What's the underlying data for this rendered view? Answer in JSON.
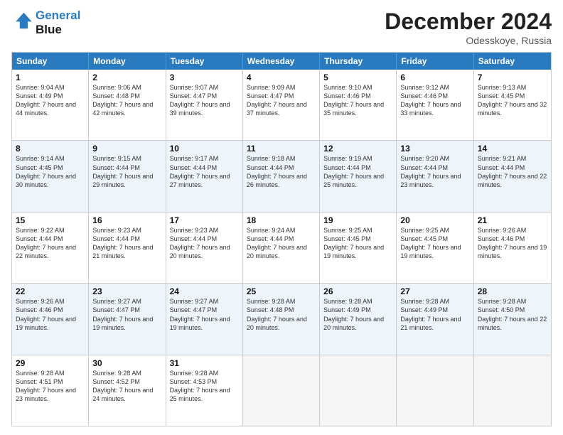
{
  "header": {
    "logo_line1": "General",
    "logo_line2": "Blue",
    "month": "December 2024",
    "location": "Odesskoye, Russia"
  },
  "days_of_week": [
    "Sunday",
    "Monday",
    "Tuesday",
    "Wednesday",
    "Thursday",
    "Friday",
    "Saturday"
  ],
  "rows": [
    [
      {
        "day": "1",
        "sunrise": "9:04 AM",
        "sunset": "4:49 PM",
        "daylight": "7 hours and 44 minutes."
      },
      {
        "day": "2",
        "sunrise": "9:06 AM",
        "sunset": "4:48 PM",
        "daylight": "7 hours and 42 minutes."
      },
      {
        "day": "3",
        "sunrise": "9:07 AM",
        "sunset": "4:47 PM",
        "daylight": "7 hours and 39 minutes."
      },
      {
        "day": "4",
        "sunrise": "9:09 AM",
        "sunset": "4:47 PM",
        "daylight": "7 hours and 37 minutes."
      },
      {
        "day": "5",
        "sunrise": "9:10 AM",
        "sunset": "4:46 PM",
        "daylight": "7 hours and 35 minutes."
      },
      {
        "day": "6",
        "sunrise": "9:12 AM",
        "sunset": "4:46 PM",
        "daylight": "7 hours and 33 minutes."
      },
      {
        "day": "7",
        "sunrise": "9:13 AM",
        "sunset": "4:45 PM",
        "daylight": "7 hours and 32 minutes."
      }
    ],
    [
      {
        "day": "8",
        "sunrise": "9:14 AM",
        "sunset": "4:45 PM",
        "daylight": "7 hours and 30 minutes."
      },
      {
        "day": "9",
        "sunrise": "9:15 AM",
        "sunset": "4:44 PM",
        "daylight": "7 hours and 29 minutes."
      },
      {
        "day": "10",
        "sunrise": "9:17 AM",
        "sunset": "4:44 PM",
        "daylight": "7 hours and 27 minutes."
      },
      {
        "day": "11",
        "sunrise": "9:18 AM",
        "sunset": "4:44 PM",
        "daylight": "7 hours and 26 minutes."
      },
      {
        "day": "12",
        "sunrise": "9:19 AM",
        "sunset": "4:44 PM",
        "daylight": "7 hours and 25 minutes."
      },
      {
        "day": "13",
        "sunrise": "9:20 AM",
        "sunset": "4:44 PM",
        "daylight": "7 hours and 23 minutes."
      },
      {
        "day": "14",
        "sunrise": "9:21 AM",
        "sunset": "4:44 PM",
        "daylight": "7 hours and 22 minutes."
      }
    ],
    [
      {
        "day": "15",
        "sunrise": "9:22 AM",
        "sunset": "4:44 PM",
        "daylight": "7 hours and 22 minutes."
      },
      {
        "day": "16",
        "sunrise": "9:23 AM",
        "sunset": "4:44 PM",
        "daylight": "7 hours and 21 minutes."
      },
      {
        "day": "17",
        "sunrise": "9:23 AM",
        "sunset": "4:44 PM",
        "daylight": "7 hours and 20 minutes."
      },
      {
        "day": "18",
        "sunrise": "9:24 AM",
        "sunset": "4:44 PM",
        "daylight": "7 hours and 20 minutes."
      },
      {
        "day": "19",
        "sunrise": "9:25 AM",
        "sunset": "4:45 PM",
        "daylight": "7 hours and 19 minutes."
      },
      {
        "day": "20",
        "sunrise": "9:25 AM",
        "sunset": "4:45 PM",
        "daylight": "7 hours and 19 minutes."
      },
      {
        "day": "21",
        "sunrise": "9:26 AM",
        "sunset": "4:46 PM",
        "daylight": "7 hours and 19 minutes."
      }
    ],
    [
      {
        "day": "22",
        "sunrise": "9:26 AM",
        "sunset": "4:46 PM",
        "daylight": "7 hours and 19 minutes."
      },
      {
        "day": "23",
        "sunrise": "9:27 AM",
        "sunset": "4:47 PM",
        "daylight": "7 hours and 19 minutes."
      },
      {
        "day": "24",
        "sunrise": "9:27 AM",
        "sunset": "4:47 PM",
        "daylight": "7 hours and 19 minutes."
      },
      {
        "day": "25",
        "sunrise": "9:28 AM",
        "sunset": "4:48 PM",
        "daylight": "7 hours and 20 minutes."
      },
      {
        "day": "26",
        "sunrise": "9:28 AM",
        "sunset": "4:49 PM",
        "daylight": "7 hours and 20 minutes."
      },
      {
        "day": "27",
        "sunrise": "9:28 AM",
        "sunset": "4:49 PM",
        "daylight": "7 hours and 21 minutes."
      },
      {
        "day": "28",
        "sunrise": "9:28 AM",
        "sunset": "4:50 PM",
        "daylight": "7 hours and 22 minutes."
      }
    ],
    [
      {
        "day": "29",
        "sunrise": "9:28 AM",
        "sunset": "4:51 PM",
        "daylight": "7 hours and 23 minutes."
      },
      {
        "day": "30",
        "sunrise": "9:28 AM",
        "sunset": "4:52 PM",
        "daylight": "7 hours and 24 minutes."
      },
      {
        "day": "31",
        "sunrise": "9:28 AM",
        "sunset": "4:53 PM",
        "daylight": "7 hours and 25 minutes."
      },
      null,
      null,
      null,
      null
    ]
  ]
}
